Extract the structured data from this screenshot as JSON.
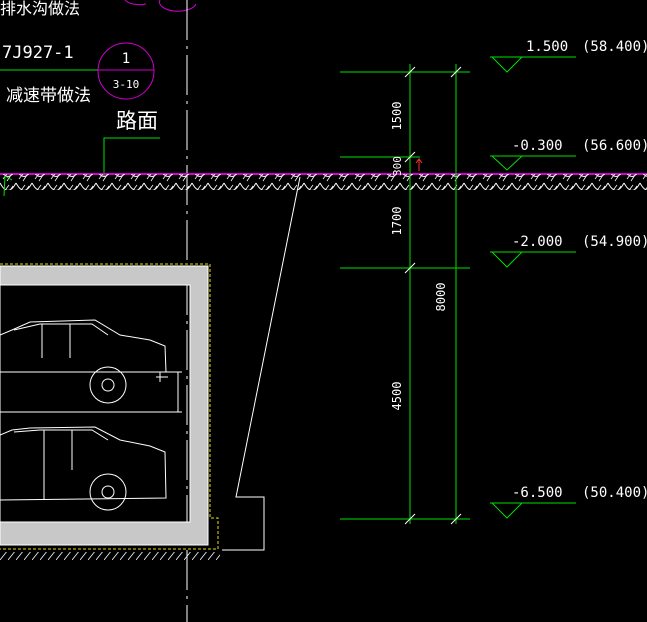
{
  "notes": {
    "drainage_method": "排水沟做法",
    "ref_code": "7J927-1",
    "detail_number": "1",
    "detail_sheet": "3-10",
    "speed_bump_method": "减速带做法",
    "road_surface": "路面"
  },
  "elevations": [
    {
      "relative": "1.500",
      "absolute": "(58.400)"
    },
    {
      "relative": "-0.300",
      "absolute": "(56.600)"
    },
    {
      "relative": "-2.000",
      "absolute": "(54.900)"
    },
    {
      "relative": "-6.500",
      "absolute": "(50.400)"
    }
  ],
  "dimensions": {
    "d1500": "1500",
    "d300": "300",
    "d1700": "1700",
    "d4500": "4500",
    "d8000": "8000"
  },
  "colors": {
    "background": "#000000",
    "dimension_lines": "#00e000",
    "outline": "#ffffff",
    "annotation_circle": "#d000d0",
    "dashed_edge": "#e8e000",
    "wall_fill": "#c8c8c8"
  }
}
